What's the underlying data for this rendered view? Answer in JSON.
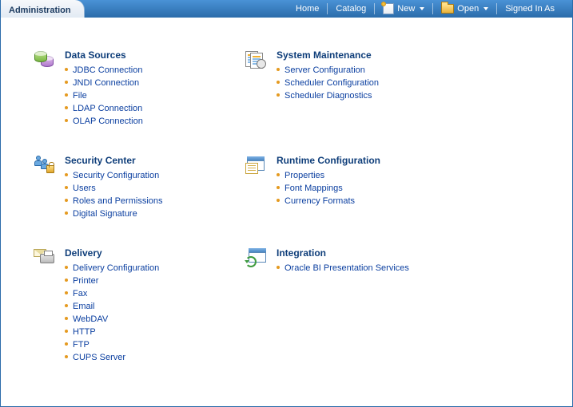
{
  "topbar": {
    "tab_title": "Administration",
    "home": "Home",
    "catalog": "Catalog",
    "new": "New",
    "open": "Open",
    "signed_in": "Signed In As"
  },
  "sections": {
    "data_sources": {
      "title": "Data Sources",
      "links": [
        "JDBC Connection",
        "JNDI Connection",
        "File",
        "LDAP Connection",
        "OLAP Connection"
      ]
    },
    "system_maintenance": {
      "title": "System Maintenance",
      "links": [
        "Server Configuration",
        "Scheduler Configuration",
        "Scheduler Diagnostics"
      ]
    },
    "security_center": {
      "title": "Security Center",
      "links": [
        "Security Configuration",
        "Users",
        "Roles and Permissions",
        "Digital Signature"
      ]
    },
    "runtime_configuration": {
      "title": "Runtime Configuration",
      "links": [
        "Properties",
        "Font Mappings",
        "Currency Formats"
      ]
    },
    "delivery": {
      "title": "Delivery",
      "links": [
        "Delivery Configuration",
        "Printer",
        "Fax",
        "Email",
        "WebDAV",
        "HTTP",
        "FTP",
        "CUPS Server"
      ]
    },
    "integration": {
      "title": "Integration",
      "links": [
        "Oracle BI Presentation Services"
      ]
    }
  }
}
